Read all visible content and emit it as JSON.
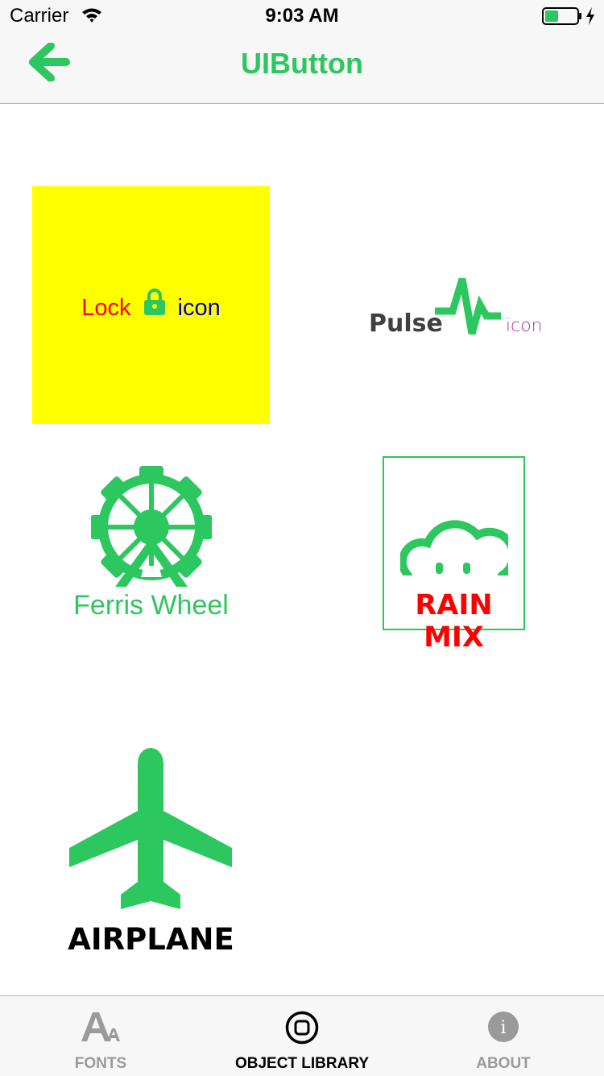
{
  "status_bar": {
    "carrier": "Carrier",
    "time": "9:03 AM",
    "battery_icon": "battery-icon",
    "wifi_icon": "wifi-icon",
    "charging_icon": "charging-bolt-icon"
  },
  "nav": {
    "title": "UIButton",
    "back_icon": "arrow-left-icon"
  },
  "colors": {
    "accent": "#2dc75f",
    "lock_background": "#ffff00",
    "lock_label": "#ff0000",
    "lock_suffix": "#0000cc",
    "pulse_suffix": "#a0409a",
    "rain_label": "#ff0000"
  },
  "buttons": {
    "lock": {
      "label": "Lock",
      "icon": "lock-icon",
      "suffix": "icon"
    },
    "pulse": {
      "label": "Pulse",
      "icon": "pulse-icon",
      "suffix": "icon"
    },
    "ferris_wheel": {
      "label": "Ferris Wheel",
      "icon": "ferris-wheel-icon"
    },
    "rain_mix": {
      "label": "RAIN MIX",
      "icon": "rain-mix-icon"
    },
    "airplane": {
      "label": "AIRPLANE",
      "icon": "airplane-icon"
    }
  },
  "tab_bar": {
    "tabs": [
      {
        "label": "FONTS",
        "icon": "fonts-icon",
        "selected": false
      },
      {
        "label": "OBJECT LIBRARY",
        "icon": "object-library-icon",
        "selected": true
      },
      {
        "label": "ABOUT",
        "icon": "info-icon",
        "selected": false
      }
    ]
  }
}
